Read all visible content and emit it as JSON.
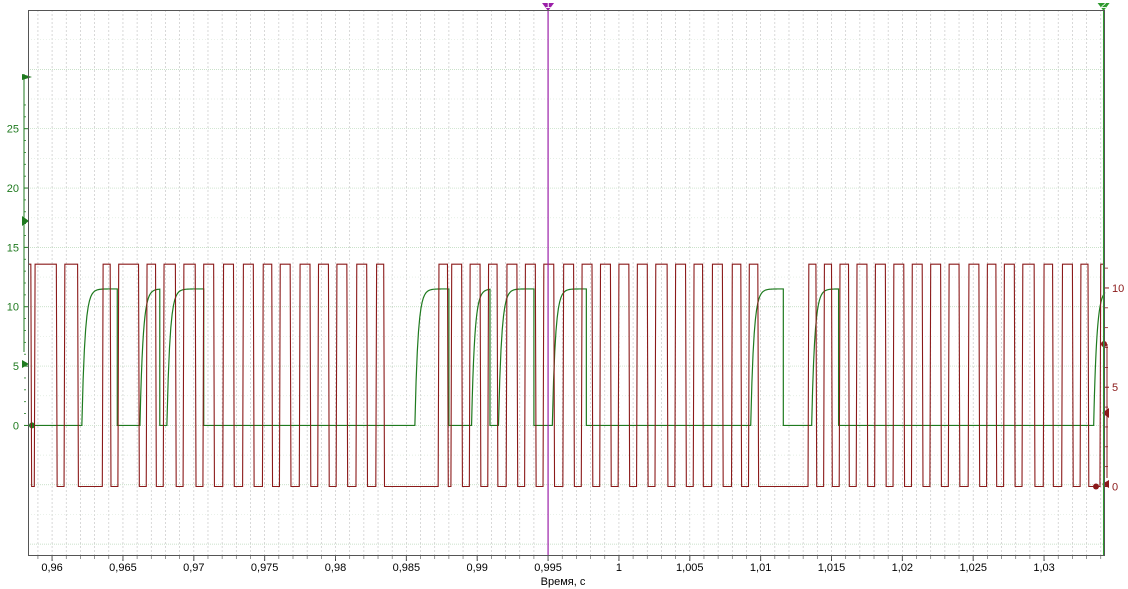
{
  "chart_data": {
    "type": "line",
    "xlabel": "Время, с",
    "xlim": [
      0.9583,
      1.0343
    ],
    "x_ticks": [
      0.96,
      0.965,
      0.97,
      0.975,
      0.98,
      0.985,
      0.99,
      0.995,
      1.0,
      1.005,
      1.01,
      1.015,
      1.02,
      1.025,
      1.03
    ],
    "x_tick_labels": [
      "0,96",
      "0,965",
      "0,97",
      "0,975",
      "0,98",
      "0,985",
      "0,99",
      "0,995",
      "1",
      "1,005",
      "1,01",
      "1,015",
      "1,02",
      "1,025",
      "1,03"
    ],
    "grid": true,
    "cursor_x": 0.995,
    "cursors": [
      {
        "label": "1",
        "x": 0.995,
        "color": "#9b1fa8"
      },
      {
        "label": "2",
        "x": 1.0342,
        "color": "#2e9a2e"
      }
    ],
    "y_left": {
      "ticks": [
        0,
        5,
        10,
        15,
        20,
        25
      ],
      "labels": [
        "0",
        "5",
        "10",
        "15",
        "20",
        "25"
      ],
      "ylim": [
        -11,
        35
      ],
      "color": "#1f7a1f"
    },
    "y_right": {
      "ticks": [
        0,
        5,
        10
      ],
      "labels": [
        "0",
        "5",
        "10"
      ],
      "ylim": [
        -3.5,
        24
      ],
      "color": "#8b1a1a"
    },
    "series": [
      {
        "color": "#1f7a1f",
        "axis": "left",
        "low": 0.0,
        "high": 11.5,
        "pulses": [
          [
            0.9621,
            0.9646
          ],
          [
            0.9662,
            0.9676
          ],
          [
            0.9681,
            0.9707
          ],
          [
            0.9856,
            0.988
          ],
          [
            0.9896,
            0.9909
          ],
          [
            0.9915,
            0.994
          ],
          [
            0.9953,
            0.9977
          ],
          [
            1.0093,
            1.0116
          ],
          [
            1.0136,
            1.0155
          ],
          [
            1.0335,
            1.0343
          ]
        ]
      },
      {
        "color": "#8b1a1a",
        "axis": "right",
        "low": 0.0,
        "high": 11.2,
        "low_intervals": [
          [
            0.9585,
            0.9588
          ],
          [
            0.9603,
            0.9609
          ],
          [
            0.9618,
            0.9636
          ],
          [
            0.9641,
            0.9647
          ],
          [
            0.9661,
            0.9667
          ],
          [
            0.9673,
            0.9679
          ],
          [
            0.9687,
            0.9693
          ],
          [
            0.9701,
            0.9707
          ],
          [
            0.9714,
            0.9721
          ],
          [
            0.9728,
            0.9735
          ],
          [
            0.9742,
            0.9749
          ],
          [
            0.9755,
            0.9761
          ],
          [
            0.9768,
            0.9775
          ],
          [
            0.9782,
            0.9788
          ],
          [
            0.9795,
            0.9801
          ],
          [
            0.9808,
            0.9815
          ],
          [
            0.9822,
            0.9829
          ],
          [
            0.9834,
            0.9873
          ],
          [
            0.9879,
            0.9882
          ],
          [
            0.9889,
            0.9895
          ],
          [
            0.9902,
            0.9908
          ],
          [
            0.9914,
            0.9921
          ],
          [
            0.9928,
            0.9934
          ],
          [
            0.9941,
            0.9947
          ],
          [
            0.9954,
            0.9961
          ],
          [
            0.9968,
            0.9974
          ],
          [
            0.9981,
            0.9987
          ],
          [
            0.9994,
            1.0
          ],
          [
            1.0007,
            1.0013
          ],
          [
            1.002,
            1.0026
          ],
          [
            1.0034,
            1.004
          ],
          [
            1.0047,
            1.0053
          ],
          [
            1.0059,
            1.0066
          ],
          [
            1.0073,
            1.008
          ],
          [
            1.0086,
            1.0092
          ],
          [
            1.0098,
            1.0134
          ],
          [
            1.0139,
            1.0145
          ],
          [
            1.015,
            1.0156
          ],
          [
            1.0162,
            1.0168
          ],
          [
            1.0175,
            1.0181
          ],
          [
            1.0188,
            1.0194
          ],
          [
            1.0201,
            1.0207
          ],
          [
            1.0214,
            1.022
          ],
          [
            1.0227,
            1.0233
          ],
          [
            1.024,
            1.0247
          ],
          [
            1.0254,
            1.026
          ],
          [
            1.0266,
            1.0272
          ],
          [
            1.0279,
            1.0285
          ],
          [
            1.0293,
            1.03
          ],
          [
            1.0306,
            1.0313
          ],
          [
            1.032,
            1.0326
          ],
          [
            1.0331,
            1.034
          ]
        ]
      }
    ]
  }
}
